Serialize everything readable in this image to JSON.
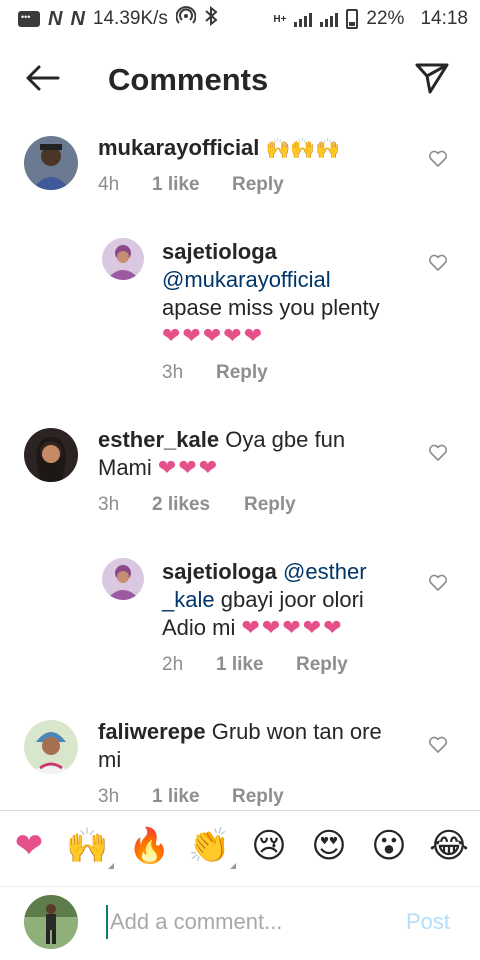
{
  "status_bar": {
    "speed": "14.39K/s",
    "network": "H+",
    "battery": "22%",
    "time": "14:18"
  },
  "header": {
    "title": "Comments",
    "back_icon": "arrow-left-icon",
    "send_icon": "paper-plane-icon"
  },
  "comments": [
    {
      "username": "mukarayofficial",
      "text": "🙌🙌🙌",
      "time": "4h",
      "likes": "1 like",
      "reply": "Reply"
    },
    {
      "username": "sajetiologa",
      "mention": "@mukarayofficial",
      "text": "apase miss you plenty",
      "hearts": "❤❤❤❤❤",
      "time": "3h",
      "reply": "Reply"
    },
    {
      "username": "esther_kale",
      "text_line1": "Oya gbe fun",
      "text_line2": "Mami",
      "hearts": "❤❤❤",
      "time": "3h",
      "likes": "2 likes",
      "reply": "Reply"
    },
    {
      "username": "sajetiologa",
      "mention_line1": "@esther",
      "mention_line2": "_kale",
      "text_line2": "gbayi joor olori",
      "text_line3": "Adio mi",
      "hearts": "❤❤❤❤❤",
      "time": "2h",
      "likes": "1 like",
      "reply": "Reply"
    },
    {
      "username": "faliwerepe",
      "text_line1": "Grub won tan ore",
      "text_line2": "mi",
      "time": "3h",
      "likes": "1 like",
      "reply": "Reply"
    }
  ],
  "emoji_bar": [
    "❤",
    "🙌",
    "🔥",
    "👏",
    "😢",
    "😍",
    "😮",
    "😂"
  ],
  "composer": {
    "placeholder": "Add a comment...",
    "post_label": "Post"
  }
}
